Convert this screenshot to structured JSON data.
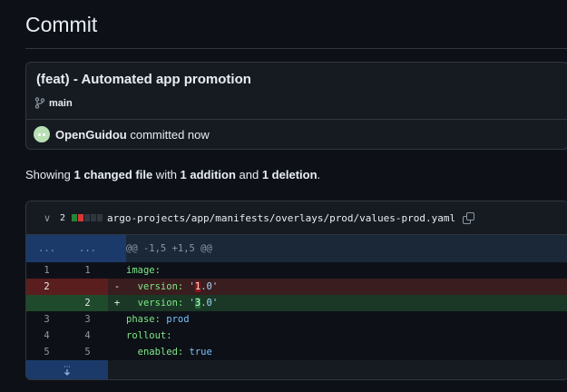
{
  "page": {
    "title": "Commit"
  },
  "commit": {
    "message": "(feat) - Automated app promotion",
    "branch": "main",
    "author": "OpenGuidou",
    "action": "committed now"
  },
  "summary": {
    "prefix": "Showing ",
    "files": "1 changed file",
    "mid1": " with ",
    "additions": "1 addition",
    "mid2": " and ",
    "deletions": "1 deletion",
    "suffix": "."
  },
  "diff": {
    "change_count": "2",
    "path": "argo-projects/app/manifests/overlays/prod/values-prod.yaml",
    "expand_dots": "...",
    "hunk_header": "@@ -1,5 +1,5 @@",
    "lines": [
      {
        "old": "1",
        "new": "1",
        "sign": "",
        "key": "image:",
        "val": ""
      },
      {
        "old": "2",
        "new": "",
        "sign": "-",
        "key": "  version:",
        "pre": " '",
        "hl": "1",
        "post": ".0'"
      },
      {
        "old": "",
        "new": "2",
        "sign": "+",
        "key": "  version:",
        "pre": " '",
        "hl": "3",
        "post": ".0'"
      },
      {
        "old": "3",
        "new": "3",
        "sign": "",
        "key": "phase:",
        "val": " prod"
      },
      {
        "old": "4",
        "new": "4",
        "sign": "",
        "key": "rollout:",
        "val": ""
      },
      {
        "old": "5",
        "new": "5",
        "sign": "",
        "key": "  enabled:",
        "val": " true"
      }
    ],
    "expand_icon": "expand-down-icon"
  },
  "colors": {
    "added": "#238636",
    "deleted": "#da3633",
    "neutral": "#30363d"
  }
}
